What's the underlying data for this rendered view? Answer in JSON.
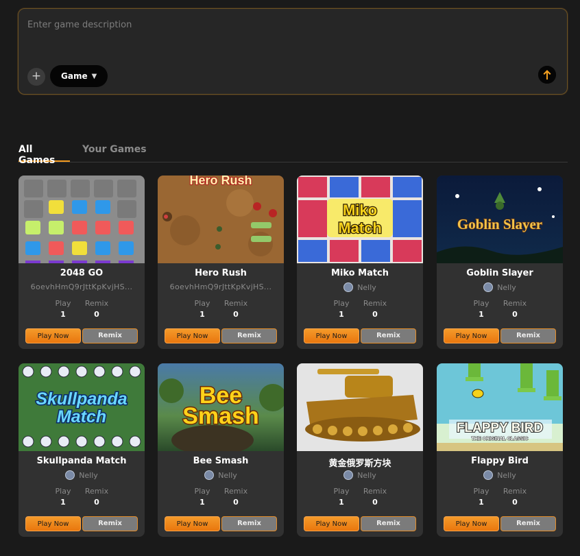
{
  "prompt": {
    "placeholder": "Enter game description",
    "type_label": "Game",
    "plus_icon": "+",
    "caret": "▼"
  },
  "tabs": [
    {
      "label": "All Games",
      "active": true
    },
    {
      "label": "Your Games",
      "active": false
    }
  ],
  "games": [
    {
      "title": "2048 GO",
      "author": "6oevhHmQ9rJttKpKvjHS...",
      "author_is_hash": true,
      "play_label": "Play",
      "play": "1",
      "remix_label": "Remix",
      "remix": "0",
      "play_btn": "Play Now",
      "remix_btn": "Remix"
    },
    {
      "title": "Hero Rush",
      "author": "6oevhHmQ9rJttKpKvjHS...",
      "author_is_hash": true,
      "play_label": "Play",
      "play": "1",
      "remix_label": "Remix",
      "remix": "0",
      "play_btn": "Play Now",
      "remix_btn": "Remix"
    },
    {
      "title": "Miko Match",
      "author": "Nelly",
      "author_is_hash": false,
      "play_label": "Play",
      "play": "1",
      "remix_label": "Remix",
      "remix": "0",
      "play_btn": "Play Now",
      "remix_btn": "Remix"
    },
    {
      "title": "Goblin Slayer",
      "author": "Nelly",
      "author_is_hash": false,
      "play_label": "Play",
      "play": "1",
      "remix_label": "Remix",
      "remix": "0",
      "play_btn": "Play Now",
      "remix_btn": "Remix"
    },
    {
      "title": "Skullpanda Match",
      "author": "Nelly",
      "author_is_hash": false,
      "play_label": "Play",
      "play": "1",
      "remix_label": "Remix",
      "remix": "0",
      "play_btn": "Play Now",
      "remix_btn": "Remix"
    },
    {
      "title": "Bee Smash",
      "author": "Nelly",
      "author_is_hash": false,
      "play_label": "Play",
      "play": "1",
      "remix_label": "Remix",
      "remix": "0",
      "play_btn": "Play Now",
      "remix_btn": "Remix"
    },
    {
      "title": "黄金俄罗斯方块",
      "author": "Nelly",
      "author_is_hash": false,
      "play_label": "Play",
      "play": "1",
      "remix_label": "Remix",
      "remix": "0",
      "play_btn": "Play Now",
      "remix_btn": "Remix"
    },
    {
      "title": "Flappy Bird",
      "author": "Nelly",
      "author_is_hash": false,
      "play_label": "Play",
      "play": "1",
      "remix_label": "Remix",
      "remix": "0",
      "play_btn": "Play Now",
      "remix_btn": "Remix"
    }
  ],
  "thumb_texts": {
    "hero": "Hero Rush",
    "miko": "Miko Match",
    "miko_a": "Miko",
    "miko_b": "Match",
    "goblin": "Goblin Slayer",
    "skull_a": "Skullpanda",
    "skull_b": "Match",
    "bee_a": "Bee",
    "bee_b": "Smash",
    "flappy_a": "FLAPPY BIRD",
    "flappy_b": "THE ORIGINAL CLASSIC"
  },
  "colors": {
    "accent": "#f39a1e",
    "card_bg": "#313131",
    "page_bg": "#1a1a1a"
  }
}
